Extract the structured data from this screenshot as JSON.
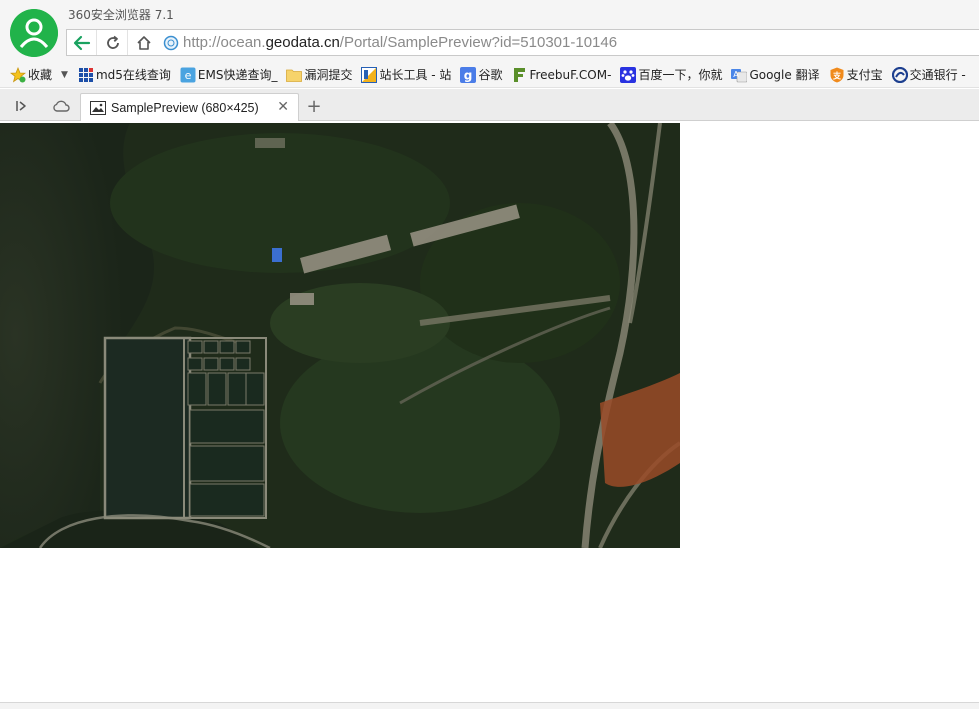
{
  "window": {
    "title": "360安全浏览器 7.1"
  },
  "address_bar": {
    "url_prefix": "http://ocean.",
    "url_domain": "geodata.cn",
    "url_path": "/Portal/SamplePreview?id=510301-10146"
  },
  "bookmarks": [
    {
      "label": "收藏",
      "icon": "star-icon"
    },
    {
      "label": "md5在线查询",
      "icon": "grid-icon"
    },
    {
      "label": "EMS快递查询_",
      "icon": "ems-icon"
    },
    {
      "label": "漏洞提交",
      "icon": "folder-icon"
    },
    {
      "label": "站长工具 - 站",
      "icon": "chinaz-icon"
    },
    {
      "label": "谷歌",
      "icon": "google-g-icon"
    },
    {
      "label": "FreebuF.COM-",
      "icon": "freebuf-icon"
    },
    {
      "label": "百度一下，你就",
      "icon": "baidu-paw-icon"
    },
    {
      "label": "Google 翻译",
      "icon": "google-translate-icon"
    },
    {
      "label": "支付宝",
      "icon": "alipay-icon"
    },
    {
      "label": "交通银行 -",
      "icon": "bankcomm-icon"
    }
  ],
  "tabs": [
    {
      "label": "SamplePreview (680×425)",
      "icon": "image-icon",
      "active": true
    }
  ],
  "page": {
    "image_alt": "satellite-image"
  },
  "colors": {
    "accent": "#21b34a",
    "back_arrow": "#1aa260"
  }
}
